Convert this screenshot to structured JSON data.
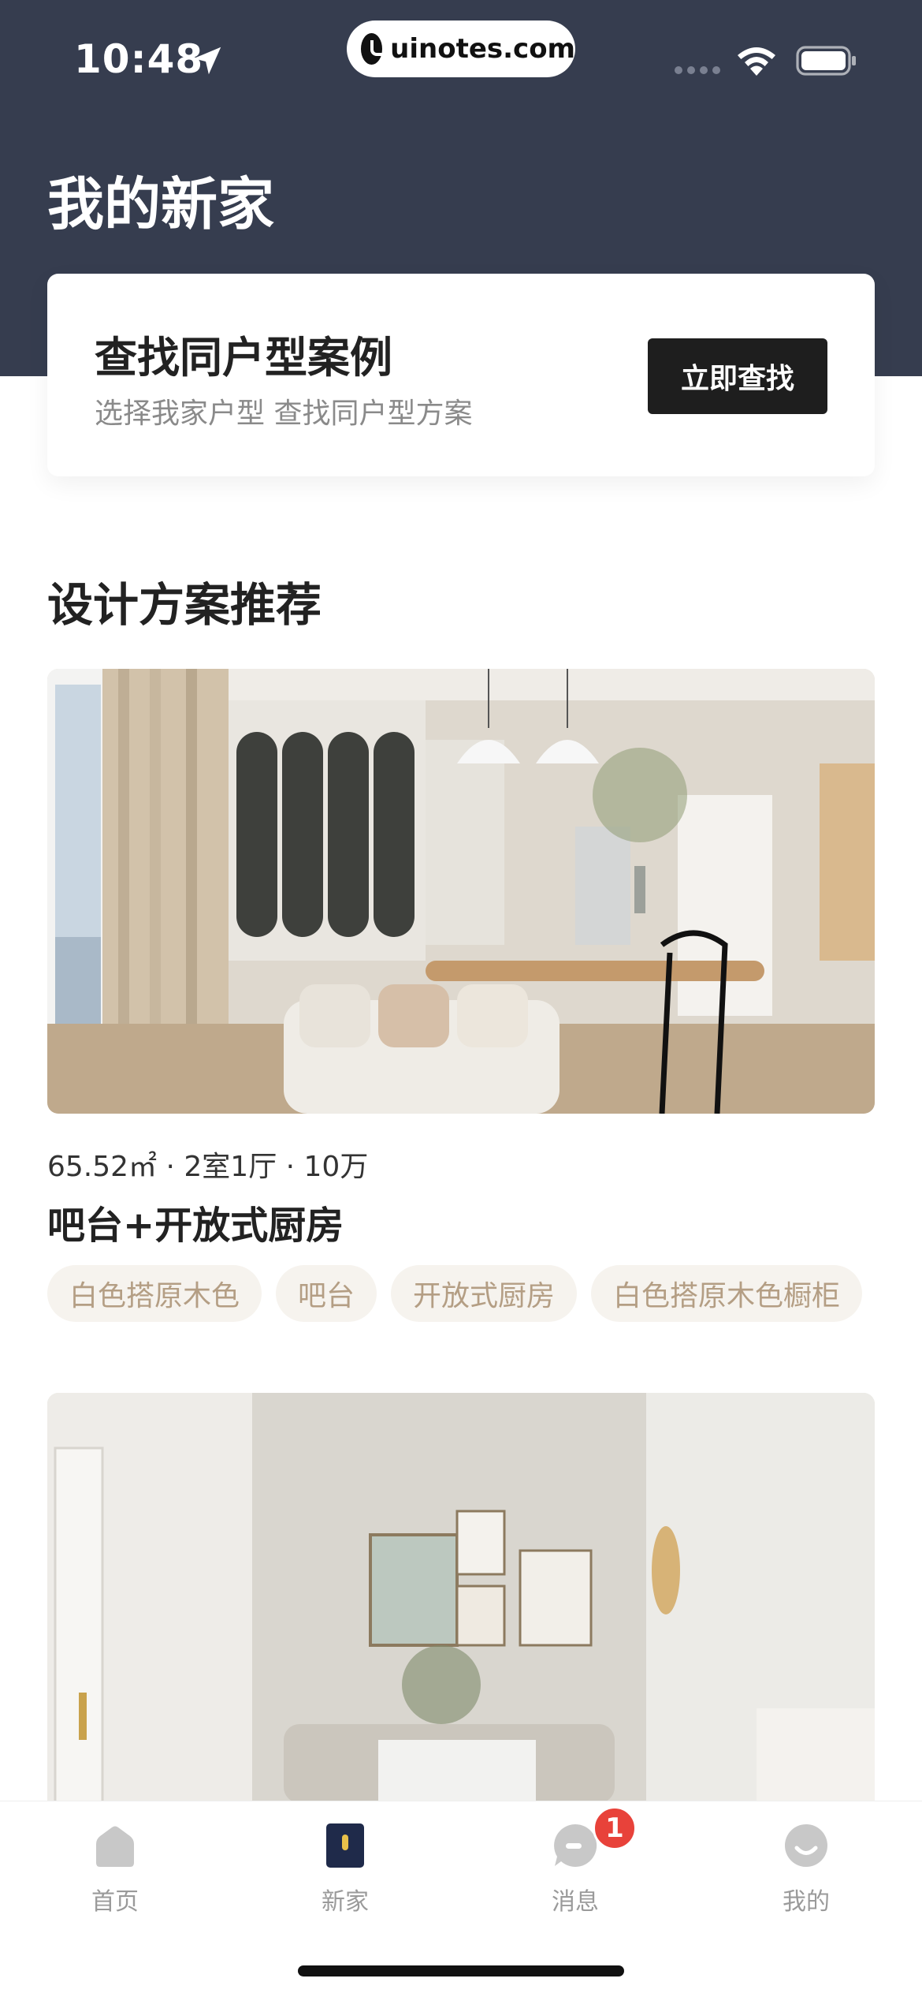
{
  "status_bar": {
    "time": "10:48",
    "url": "uinotes.com"
  },
  "page_title": "我的新家",
  "search_card": {
    "title": "查找同户型案例",
    "subtitle": "选择我家户型 查找同户型方案",
    "button_label": "立即查找"
  },
  "section_title": "设计方案推荐",
  "designs": [
    {
      "meta": "65.52㎡ · 2室1厅 · 10万",
      "title": "吧台+开放式厨房",
      "tags": [
        "白色搭原木色",
        "吧台",
        "开放式厨房",
        "白色搭原木色橱柜"
      ]
    }
  ],
  "tab_bar": {
    "items": [
      {
        "label": "首页",
        "icon": "home-icon",
        "active": false
      },
      {
        "label": "新家",
        "icon": "new-home-icon",
        "active": true
      },
      {
        "label": "消息",
        "icon": "message-icon",
        "active": false
      },
      {
        "label": "我的",
        "icon": "profile-icon",
        "active": false
      }
    ],
    "message_badge": "1"
  },
  "colors": {
    "header": "#363d4f",
    "tag_bg": "#f6f3ee",
    "tag_text": "#b49e84",
    "badge": "#e8423a",
    "active_icon": "#1f2a4a"
  }
}
